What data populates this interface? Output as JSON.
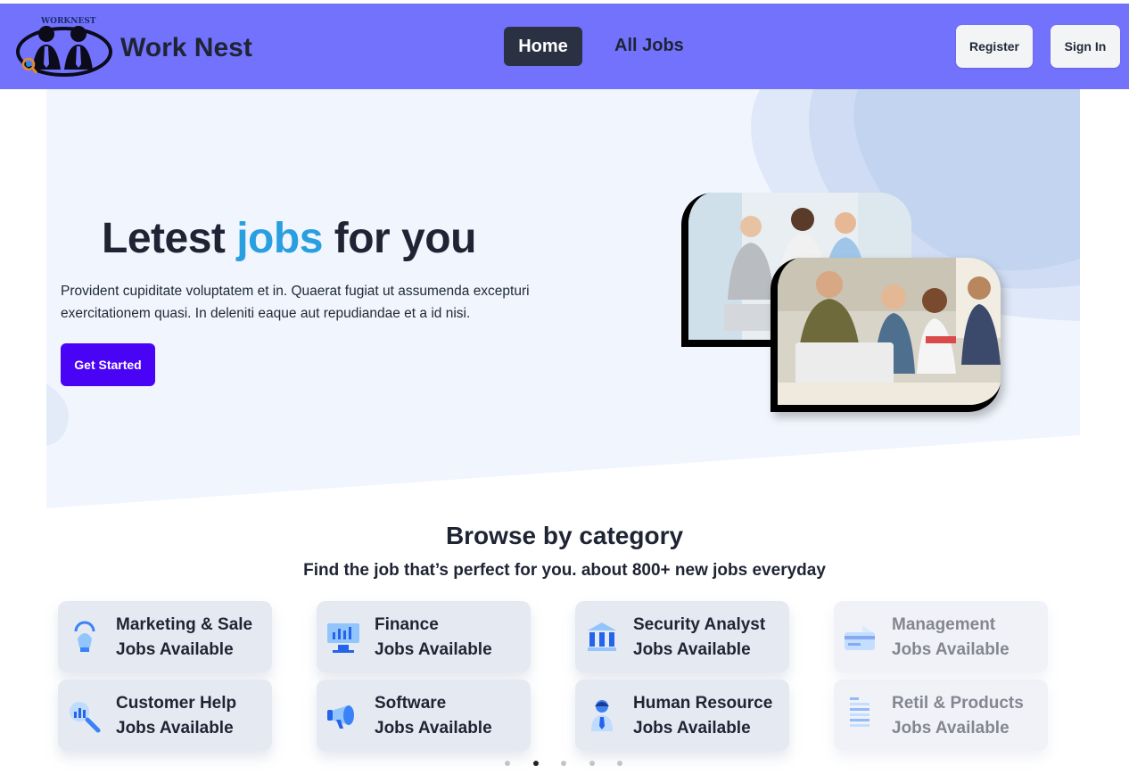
{
  "header": {
    "logo_text": "WORKNEST",
    "brand": "Work Nest",
    "nav": [
      {
        "label": "Home",
        "active": true
      },
      {
        "label": "All Jobs",
        "active": false
      }
    ],
    "register_label": "Register",
    "signin_label": "Sign In",
    "bg_color": "#7372fd"
  },
  "hero": {
    "title_pre": "Letest ",
    "title_accent": "jobs",
    "title_post": " for you",
    "description": "Provident cupiditate voluptatem et in. Quaerat fugiat ut assumenda excepturi exercitationem quasi. In deleniti eaque aut repudiandae et a id nisi.",
    "cta_label": "Get Started",
    "accent_color": "#2a9fe0",
    "cta_color": "#4a04f5"
  },
  "categories": {
    "title": "Browse by category",
    "subtitle": "Find the job that’s perfect for you. about 800+ new jobs everyday",
    "items": [
      {
        "name": "Marketing & Sale",
        "sub": "Jobs Available",
        "icon": "lightbulb-icon"
      },
      {
        "name": "Finance",
        "sub": "Jobs Available",
        "icon": "chart-monitor-icon"
      },
      {
        "name": "Security Analyst",
        "sub": "Jobs Available",
        "icon": "bank-icon"
      },
      {
        "name": "Management",
        "sub": "Jobs Available",
        "icon": "credit-card-icon"
      },
      {
        "name": "Customer Help",
        "sub": "Jobs Available",
        "icon": "analytics-search-icon"
      },
      {
        "name": "Software",
        "sub": "Jobs Available",
        "icon": "megaphone-icon"
      },
      {
        "name": "Human Resource",
        "sub": "Jobs Available",
        "icon": "person-icon"
      },
      {
        "name": "Retil & Products",
        "sub": "Jobs Available",
        "icon": "document-icon"
      }
    ]
  },
  "carousel": {
    "count": 5,
    "active_index": 1
  }
}
